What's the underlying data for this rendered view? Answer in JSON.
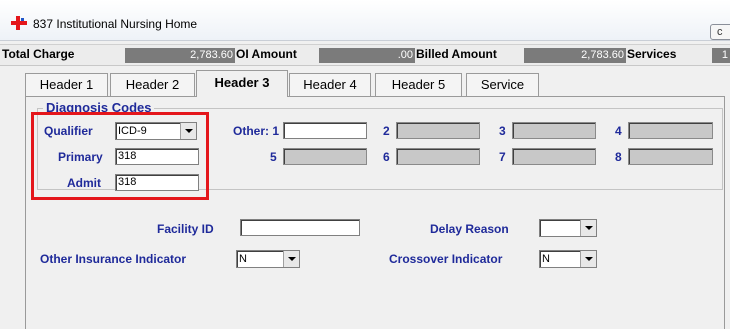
{
  "window": {
    "title": "837 Institutional Nursing Home",
    "corner_button": "c"
  },
  "totals": {
    "total_charge_label": "Total Charge",
    "total_charge_value": "2,783.60",
    "oi_amount_label": "OI Amount",
    "oi_amount_value": ".00",
    "billed_amount_label": "Billed Amount",
    "billed_amount_value": "2,783.60",
    "services_label": "Services",
    "services_value": "1"
  },
  "tabs": [
    {
      "label": "Header 1"
    },
    {
      "label": "Header 2"
    },
    {
      "label": "Header 3",
      "active": true
    },
    {
      "label": "Header 4"
    },
    {
      "label": "Header 5"
    },
    {
      "label": "Service"
    }
  ],
  "diagnosis": {
    "legend": "Diagnosis Codes",
    "qualifier_label": "Qualifier",
    "qualifier_value": "ICD-9",
    "primary_label": "Primary",
    "primary_value": "318",
    "admit_label": "Admit",
    "admit_value": "318",
    "other_label": "Other: 1",
    "other_numbers": [
      "2",
      "3",
      "4",
      "5",
      "6",
      "7",
      "8"
    ]
  },
  "form": {
    "facility_id_label": "Facility ID",
    "facility_id_value": "",
    "delay_reason_label": "Delay Reason",
    "delay_reason_value": "",
    "other_insurance_label": "Other Insurance Indicator",
    "other_insurance_value": "N",
    "crossover_label": "Crossover Indicator",
    "crossover_value": "N"
  },
  "colors": {
    "label_blue": "#1f2a9a",
    "highlight_red": "#e4161b",
    "total_value_bg": "#7b7b7b"
  }
}
